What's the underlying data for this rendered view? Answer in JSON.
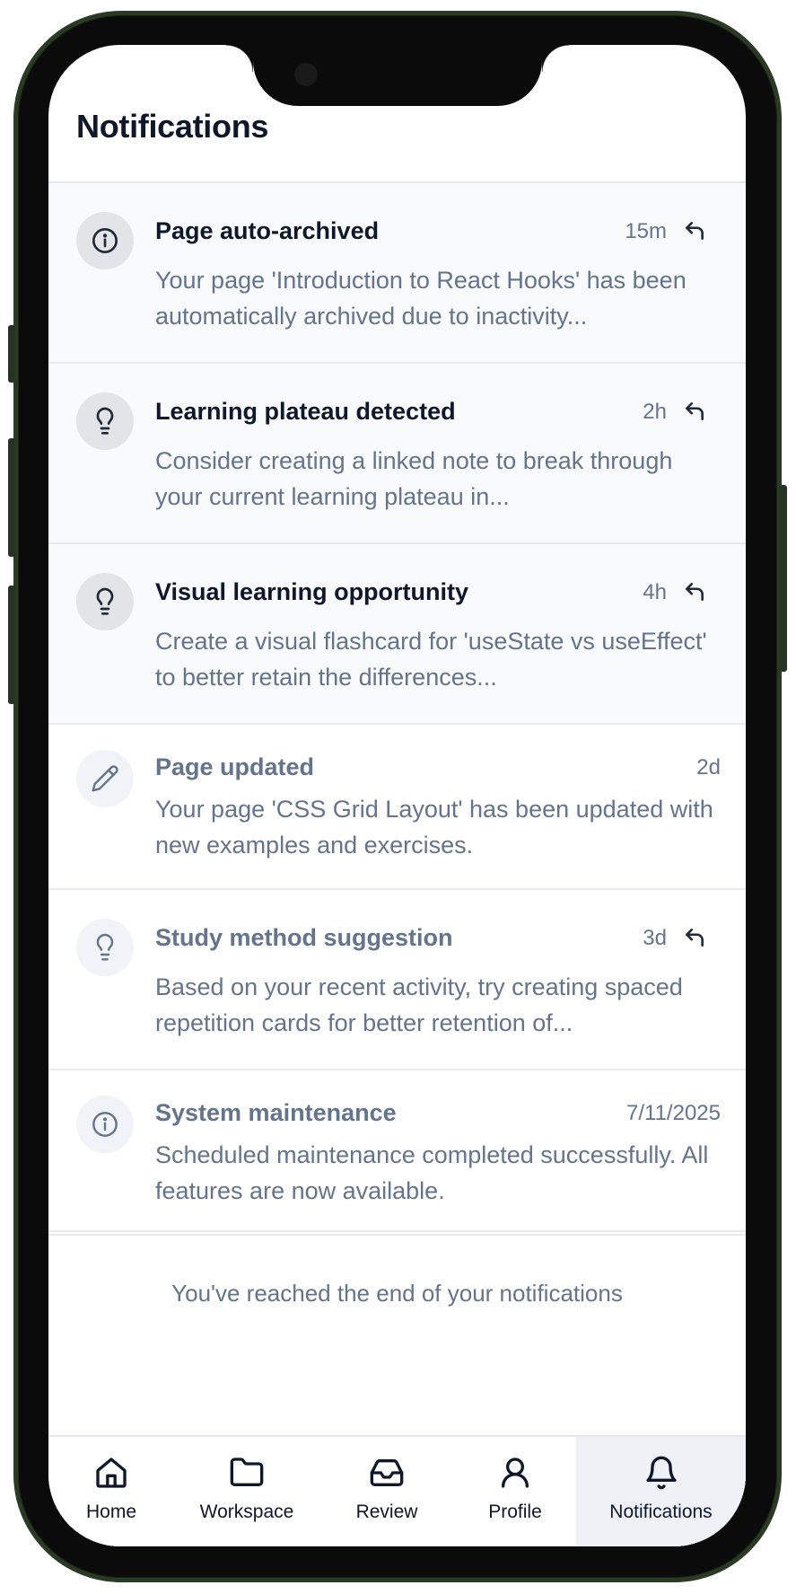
{
  "page": {
    "title": "Notifications"
  },
  "notifications": [
    {
      "title": "Page auto-archived",
      "time": "15m",
      "body": "Your page 'Introduction to React Hooks' has been automatically archived due to inactivity...",
      "icon": "info-icon",
      "unread": true,
      "reply": true
    },
    {
      "title": "Learning plateau detected",
      "time": "2h",
      "body": "Consider creating a linked note to break through your current learning plateau in...",
      "icon": "lightbulb-icon",
      "unread": true,
      "reply": true
    },
    {
      "title": "Visual learning opportunity",
      "time": "4h",
      "body": "Create a visual flashcard for 'useState vs useEffect' to better retain the differences...",
      "icon": "lightbulb-icon",
      "unread": true,
      "reply": true
    },
    {
      "title": "Page updated",
      "time": "2d",
      "body": "Your page 'CSS Grid Layout' has been updated with new examples and exercises.",
      "icon": "pencil-icon",
      "unread": false,
      "reply": false
    },
    {
      "title": "Study method suggestion",
      "time": "3d",
      "body": "Based on your recent activity, try creating spaced repetition cards for better retention of...",
      "icon": "lightbulb-icon",
      "unread": false,
      "reply": true
    },
    {
      "title": "System maintenance",
      "time": "7/11/2025",
      "body": "Scheduled maintenance completed successfully. All features are now available.",
      "icon": "info-icon",
      "unread": false,
      "reply": false
    }
  ],
  "end_message": "You've reached the end of your notifications",
  "tabbar": {
    "tabs": [
      {
        "label": "Home",
        "icon": "home-icon"
      },
      {
        "label": "Workspace",
        "icon": "folder-icon"
      },
      {
        "label": "Review",
        "icon": "inbox-icon"
      },
      {
        "label": "Profile",
        "icon": "user-icon"
      },
      {
        "label": "Notifications",
        "icon": "bell-icon",
        "active": true
      }
    ]
  },
  "colors": {
    "unread_bg": "#f8fafc",
    "text_dark": "#0f172a",
    "text_muted": "#64748b",
    "active_tab_bg": "#eef2f7",
    "frame": "#2a3a24"
  }
}
